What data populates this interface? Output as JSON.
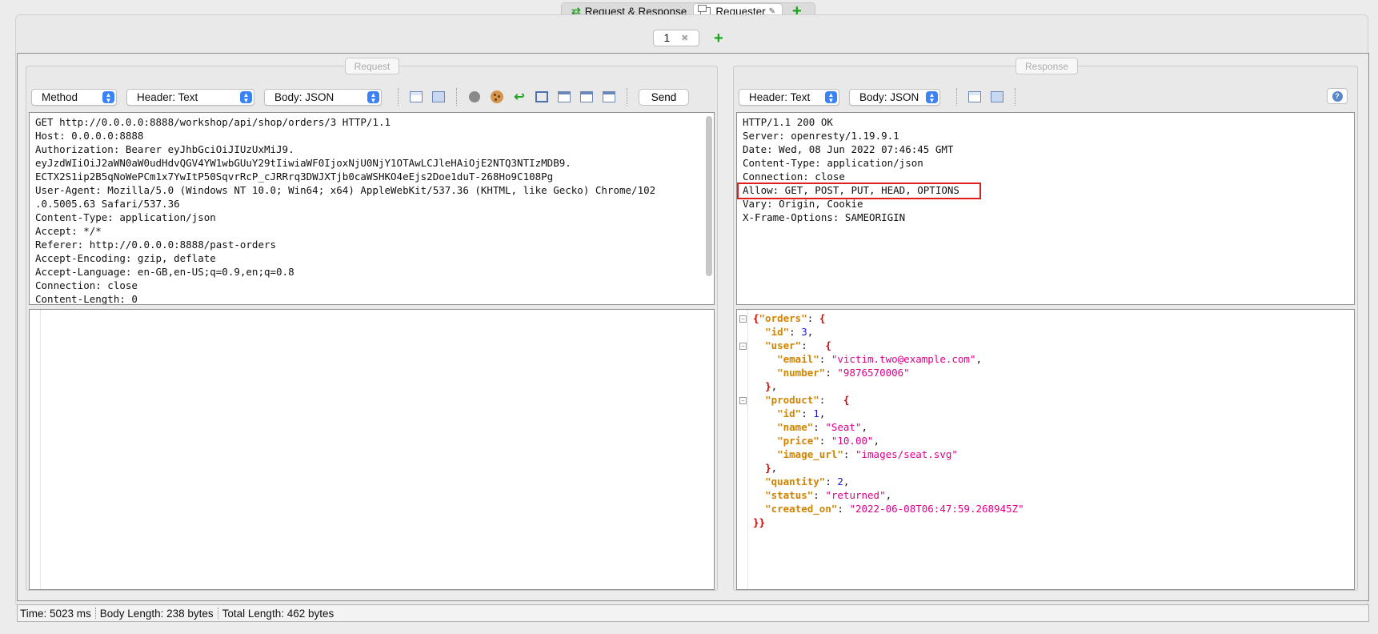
{
  "top_tabs": [
    {
      "label": "Request & Response"
    },
    {
      "label": "Requester"
    }
  ],
  "sub_tabs": [
    {
      "label": "1"
    }
  ],
  "request": {
    "legend": "Request",
    "method": "Method",
    "header_mode": "Header: Text",
    "body_mode": "Body: JSON",
    "send_label": "Send",
    "headers": [
      "GET http://0.0.0.0:8888/workshop/api/shop/orders/3 HTTP/1.1",
      "Host: 0.0.0.0:8888",
      "Authorization: Bearer eyJhbGciOiJIUzUxMiJ9.",
      "eyJzdWIiOiJ2aWN0aW0udHdvQGV4YW1wbGUuY29tIiwiaWF0IjoxNjU0NjY1OTAwLCJleHAiOjE2NTQ3NTIzMDB9.",
      "ECTX2S1ip2B5qNoWePCm1x7YwItP50SqvrRcP_cJRRrq3DWJXTjb0caWSHKO4eEjs2Doe1duT-268Ho9C108Pg",
      "User-Agent: Mozilla/5.0 (Windows NT 10.0; Win64; x64) AppleWebKit/537.36 (KHTML, like Gecko) Chrome/102",
      ".0.5005.63 Safari/537.36",
      "Content-Type: application/json",
      "Accept: */*",
      "Referer: http://0.0.0.0:8888/past-orders",
      "Accept-Encoding: gzip, deflate",
      "Accept-Language: en-GB,en-US;q=0.9,en;q=0.8",
      "Connection: close",
      "Content-Length: 0"
    ]
  },
  "response": {
    "legend": "Response",
    "header_mode": "Header: Text",
    "body_mode": "Body: JSON",
    "headers": [
      "HTTP/1.1 200 OK",
      "Server: openresty/1.19.9.1",
      "Date: Wed, 08 Jun 2022 07:46:45 GMT",
      "Content-Type: application/json",
      "Connection: close",
      "Allow: GET, POST, PUT, HEAD, OPTIONS",
      "Vary: Origin, Cookie",
      "X-Frame-Options: SAMEORIGIN"
    ],
    "body": {
      "orders_key": "\"orders\"",
      "id_key": "\"id\"",
      "id_val": "3",
      "user_key": "\"user\"",
      "email_key": "\"email\"",
      "email_val": "\"victim.two@example.com\"",
      "number_key": "\"number\"",
      "number_val": "\"9876570006\"",
      "product_key": "\"product\"",
      "pid_key": "\"id\"",
      "pid_val": "1",
      "name_key": "\"name\"",
      "name_val": "\"Seat\"",
      "price_key": "\"price\"",
      "price_val": "\"10.00\"",
      "image_key": "\"image_url\"",
      "image_val": "\"images/seat.svg\"",
      "quantity_key": "\"quantity\"",
      "quantity_val": "2",
      "status_key": "\"status\"",
      "status_val": "\"returned\"",
      "created_key": "\"created_on\"",
      "created_val": "\"2022-06-08T06:47:59.268945Z\""
    }
  },
  "status_bar": {
    "time": "Time: 5023 ms",
    "body_length": "Body Length: 238 bytes",
    "total_length": "Total Length: 462 bytes"
  },
  "colors": {
    "highlight": "#e01e1e",
    "json_key": "#d08400",
    "json_string": "#e0008a",
    "json_number": "#1b1bd0"
  }
}
